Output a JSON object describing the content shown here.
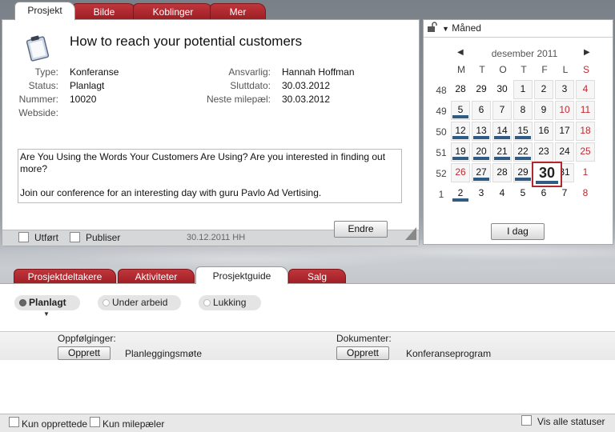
{
  "top_tabs": [
    "Prosjekt",
    "Bilde",
    "Koblinger",
    "Mer"
  ],
  "project": {
    "title": "How to reach your potential customers",
    "fields_left": [
      {
        "label": "Type:",
        "value": "Konferanse"
      },
      {
        "label": "Status:",
        "value": "Planlagt"
      },
      {
        "label": "Nummer:",
        "value": "10020"
      },
      {
        "label": "Webside:",
        "value": ""
      }
    ],
    "fields_right": [
      {
        "label": "Ansvarlig:",
        "value": "Hannah Hoffman"
      },
      {
        "label": "Sluttdato:",
        "value": "30.03.2012"
      },
      {
        "label": "Neste milepæl:",
        "value": "30.03.2012"
      }
    ],
    "description": [
      "Are You Using the Words Your Customers Are Using? Are you interested in finding out more?",
      "Join our conference for an interesting day with guru Pavlo Ad Vertising."
    ],
    "done_label": "Utført",
    "publish_label": "Publiser",
    "footer_info": "30.12.2011 HH",
    "edit_button": "Endre"
  },
  "calendar": {
    "view_label": "Måned",
    "month_label": "desember 2011",
    "weekdays": [
      "M",
      "T",
      "O",
      "T",
      "F",
      "L",
      "S"
    ],
    "weeks": [
      "48",
      "49",
      "50",
      "51",
      "52",
      "1"
    ],
    "today_button": "I dag",
    "today_value": "30",
    "days": [
      [
        "28",
        "29",
        "30",
        "1",
        "2",
        "3",
        "4"
      ],
      [
        "5",
        "6",
        "7",
        "8",
        "9",
        "10",
        "11"
      ],
      [
        "12",
        "13",
        "14",
        "15",
        "16",
        "17",
        "18"
      ],
      [
        "19",
        "20",
        "21",
        "22",
        "23",
        "24",
        "25"
      ],
      [
        "26",
        "27",
        "28",
        "29",
        "30",
        "31",
        "1"
      ],
      [
        "2",
        "3",
        "4",
        "5",
        "6",
        "7",
        "8"
      ]
    ]
  },
  "bottom_tabs": [
    "Prosjektdeltakere",
    "Aktiviteter",
    "Prosjektguide",
    "Salg"
  ],
  "stages": [
    "Planlagt",
    "Under arbeid",
    "Lukking"
  ],
  "followups": {
    "label": "Oppfølginger:",
    "button": "Opprett",
    "item": "Planleggingsmøte"
  },
  "documents": {
    "label": "Dokumenter:",
    "button": "Opprett",
    "item": "Konferanseprogram"
  },
  "footer": {
    "only_created": "Kun opprettede",
    "only_milestones": "Kun milepæler",
    "show_all": "Vis alle statuser"
  }
}
